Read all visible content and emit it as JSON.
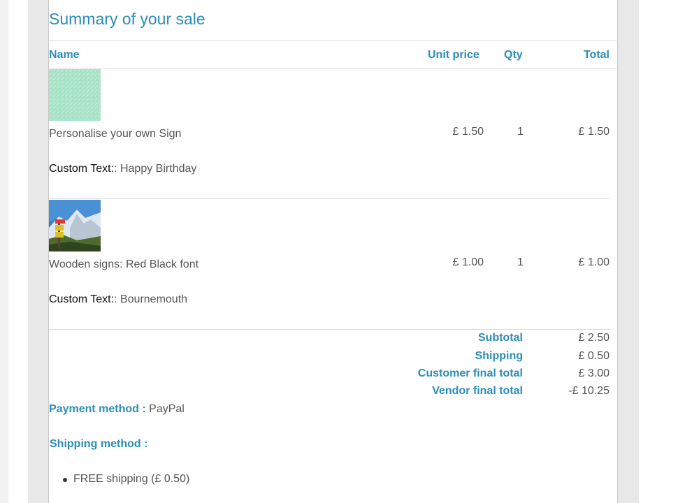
{
  "summary": {
    "title": "Summary of your sale"
  },
  "table": {
    "headers": {
      "name": "Name",
      "unit_price": "Unit price",
      "qty": "Qty",
      "total": "Total"
    },
    "items": [
      {
        "name": "Personalise your own Sign",
        "custom_label": "Custom Text:",
        "custom_value": ": Happy Birthday",
        "unit_price": "£ 1.50",
        "qty": "1",
        "total": "£ 1.50",
        "thumbnail": "mint-texture-image"
      },
      {
        "name": "Wooden signs: Red Black font",
        "custom_label": "Custom Text:",
        "custom_value": ": Bournemouth",
        "unit_price": "£ 1.00",
        "qty": "1",
        "total": "£ 1.00",
        "thumbnail": "mountain-signpost-image"
      }
    ]
  },
  "totals": {
    "subtotal_label": "Subtotal",
    "subtotal_value": "£ 2.50",
    "shipping_label": "Shipping",
    "shipping_value": "£ 0.50",
    "customer_final_label": "Customer final total",
    "customer_final_value": "£ 3.00",
    "vendor_final_label": "Vendor final total",
    "vendor_final_value": "-£ 10.25"
  },
  "payment": {
    "label": "Payment method :",
    "value": "PayPal"
  },
  "shipping_method": {
    "label": "Shipping method :",
    "options": [
      "FREE shipping (£ 0.50)"
    ]
  },
  "colors": {
    "accent": "#2a8db8",
    "text": "#555555",
    "gutter": "#e8e8e8"
  }
}
